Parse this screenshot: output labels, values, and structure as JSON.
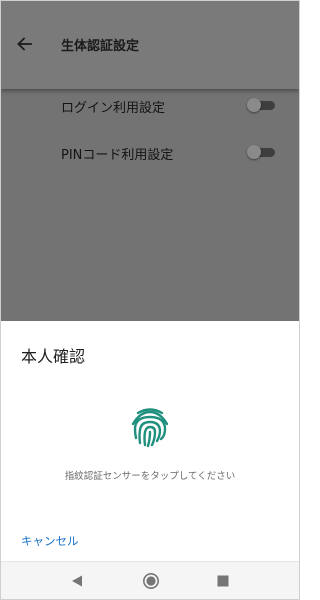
{
  "appbar": {
    "title": "生体認証設定",
    "back_icon": "arrow-back-icon"
  },
  "settings": [
    {
      "label": "ログイン利用設定",
      "enabled": false
    },
    {
      "label": "PINコード利用設定",
      "enabled": false
    }
  ],
  "dialog": {
    "title": "本人確認",
    "icon": "fingerprint-icon",
    "hint": "指紋認証センサーをタップしてください",
    "cancel_label": "キャンセル"
  },
  "navbar": {
    "back_icon": "nav-back-icon",
    "home_icon": "nav-home-icon",
    "recent_icon": "nav-recent-icon"
  },
  "colors": {
    "accent": "#1a73c8",
    "fingerprint": "#1f8f7e",
    "scrim": "#737373"
  }
}
